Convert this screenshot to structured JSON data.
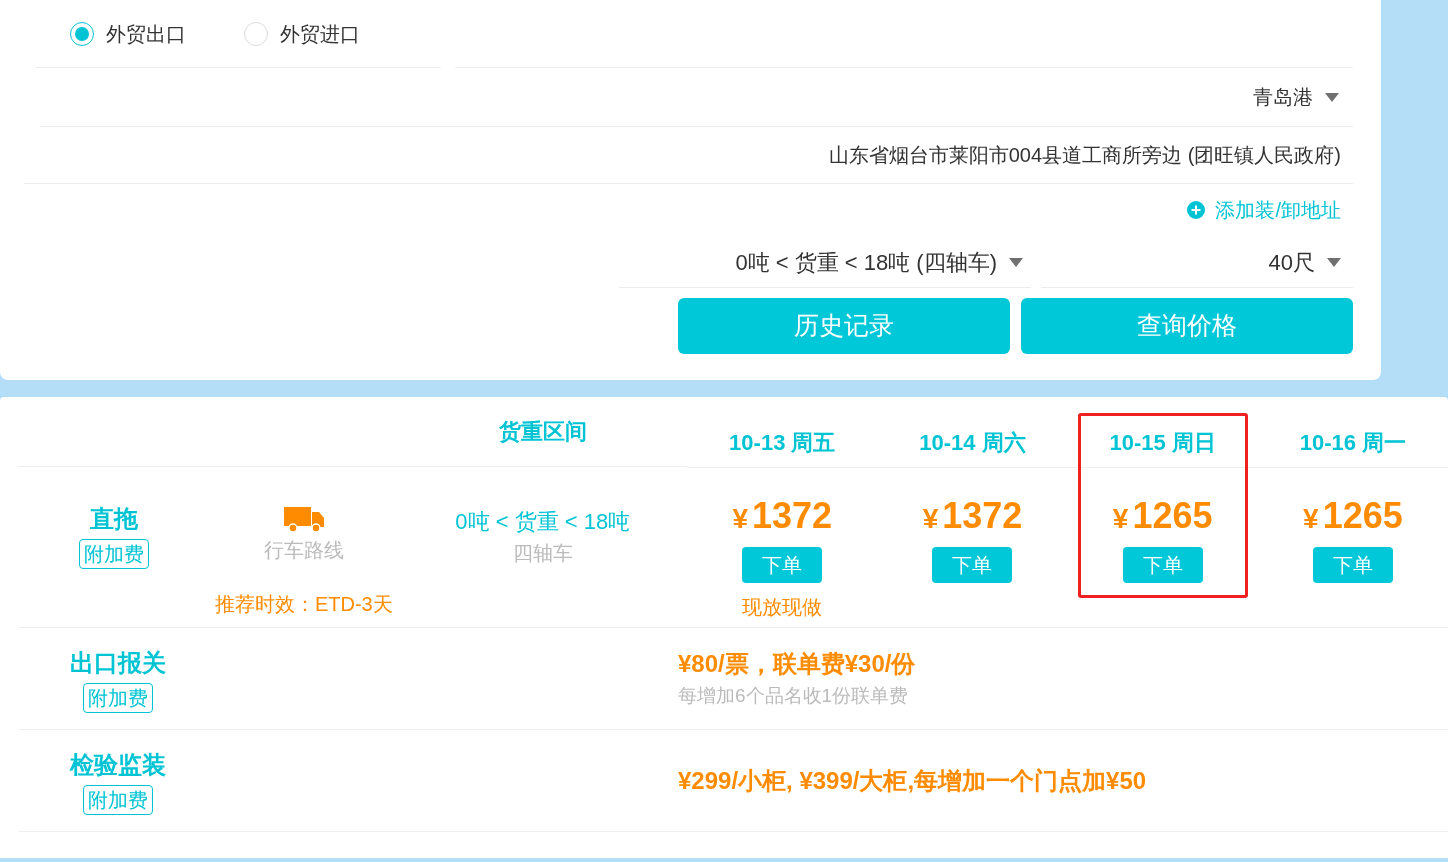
{
  "trade_type": [
    {
      "label": "外贸出口",
      "selected": true
    },
    {
      "label": "外贸进口",
      "selected": false
    }
  ],
  "port": "青岛港",
  "address": "山东省烟台市莱阳市004县道工商所旁边 (团旺镇人民政府)",
  "add_address_link": "添加装/卸地址",
  "weight_select": "0吨 < 货重 < 18吨 (四轴车)",
  "container_select": "40尺",
  "buttons": [
    "历史记录",
    "查询价格"
  ],
  "table": {
    "weight_header": "货重区间",
    "dates": [
      {
        "label": "10-13 周五",
        "selected": false
      },
      {
        "label": "10-14 周六",
        "selected": false
      },
      {
        "label": "10-15 周日",
        "selected": true
      },
      {
        "label": "10-16 周一",
        "selected": false
      }
    ],
    "trucking": {
      "name": "直拖",
      "tag": "附加费",
      "route_link": "行车路线",
      "eta": "推荐时效：ETD-3天",
      "weight_range": "0吨 < 货重 < 18吨",
      "vehicle": "四轴车",
      "prices": [
        {
          "currency": "¥",
          "price": "1372",
          "button": "下单",
          "note": "现放现做"
        },
        {
          "currency": "¥",
          "price": "1372",
          "button": "下单"
        },
        {
          "currency": "¥",
          "price": "1265",
          "button": "下单"
        },
        {
          "currency": "¥",
          "price": "1265",
          "button": "下单"
        }
      ]
    },
    "fees": [
      {
        "name": "出口报关",
        "tag": "附加费",
        "price_text": "¥80/票，联单费¥30/份",
        "note": "每增加6个品名收1份联单费"
      },
      {
        "name": "检验监装",
        "tag": "附加费",
        "price_text": "¥299/小柜, ¥399/大柜,每增加一个门点加¥50"
      }
    ]
  }
}
